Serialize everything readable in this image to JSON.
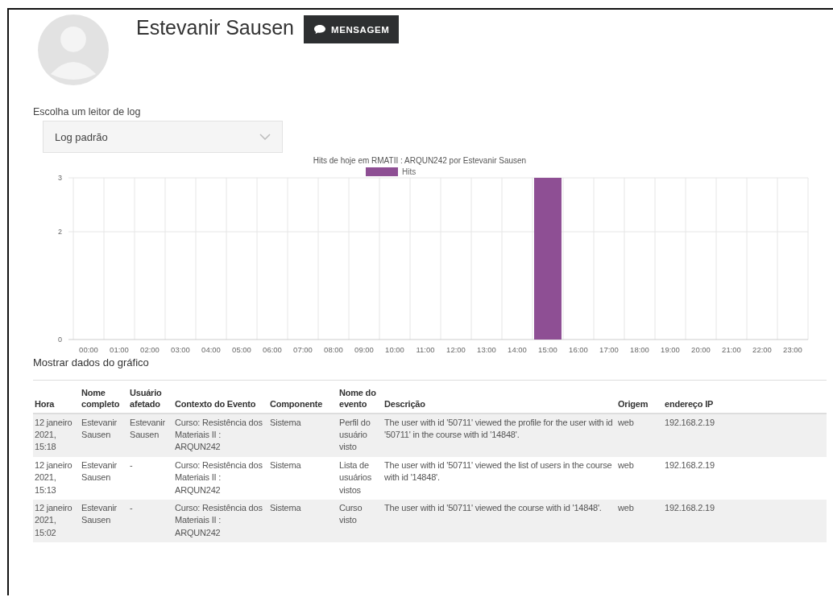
{
  "profile": {
    "name": "Estevanir Sausen",
    "message_button": "MENSAGEM"
  },
  "log_reader": {
    "label": "Escolha um leitor de log",
    "value": "Log padrão"
  },
  "chart": {
    "chart_data": {
      "type": "bar",
      "title": "Hits de hoje em RMATII : ARQUN242 por Estevanir Sausen",
      "categories": [
        "00:00",
        "01:00",
        "02:00",
        "03:00",
        "04:00",
        "05:00",
        "06:00",
        "07:00",
        "08:00",
        "09:00",
        "10:00",
        "11:00",
        "12:00",
        "13:00",
        "14:00",
        "15:00",
        "16:00",
        "17:00",
        "18:00",
        "19:00",
        "20:00",
        "21:00",
        "22:00",
        "23:00"
      ],
      "series": [
        {
          "name": "Hits",
          "color": "#8e4f94",
          "values": [
            0,
            0,
            0,
            0,
            0,
            0,
            0,
            0,
            0,
            0,
            0,
            0,
            0,
            0,
            0,
            3,
            0,
            0,
            0,
            0,
            0,
            0,
            0,
            0
          ]
        }
      ],
      "ylim": [
        0,
        3
      ],
      "yticks": [
        0,
        2,
        3
      ]
    }
  },
  "show_data_link": "Mostrar dados do gráfico",
  "table": {
    "columns": [
      "Hora",
      "Nome completo",
      "Usuário afetado",
      "Contexto do Evento",
      "Componente",
      "Nome do evento",
      "Descrição",
      "Origem",
      "endereço IP"
    ],
    "rows": [
      [
        "12 janeiro 2021, 15:18",
        "Estevanir Sausen",
        "Estevanir Sausen",
        "Curso: Resistência dos Materiais II : ARQUN242",
        "Sistema",
        "Perfil do usuário visto",
        "The user with id '50711' viewed the profile for the user with id '50711' in the course with id '14848'.",
        "web",
        "192.168.2.19"
      ],
      [
        "12 janeiro 2021, 15:13",
        "Estevanir Sausen",
        "-",
        "Curso: Resistência dos Materiais II : ARQUN242",
        "Sistema",
        "Lista de usuários vistos",
        "The user with id '50711' viewed the list of users in the course with id '14848'.",
        "web",
        "192.168.2.19"
      ],
      [
        "12 janeiro 2021, 15:02",
        "Estevanir Sausen",
        "-",
        "Curso: Resistência dos Materiais II : ARQUN242",
        "Sistema",
        "Curso visto",
        "The user with id '50711' viewed the course with id '14848'.",
        "web",
        "192.168.2.19"
      ]
    ]
  }
}
